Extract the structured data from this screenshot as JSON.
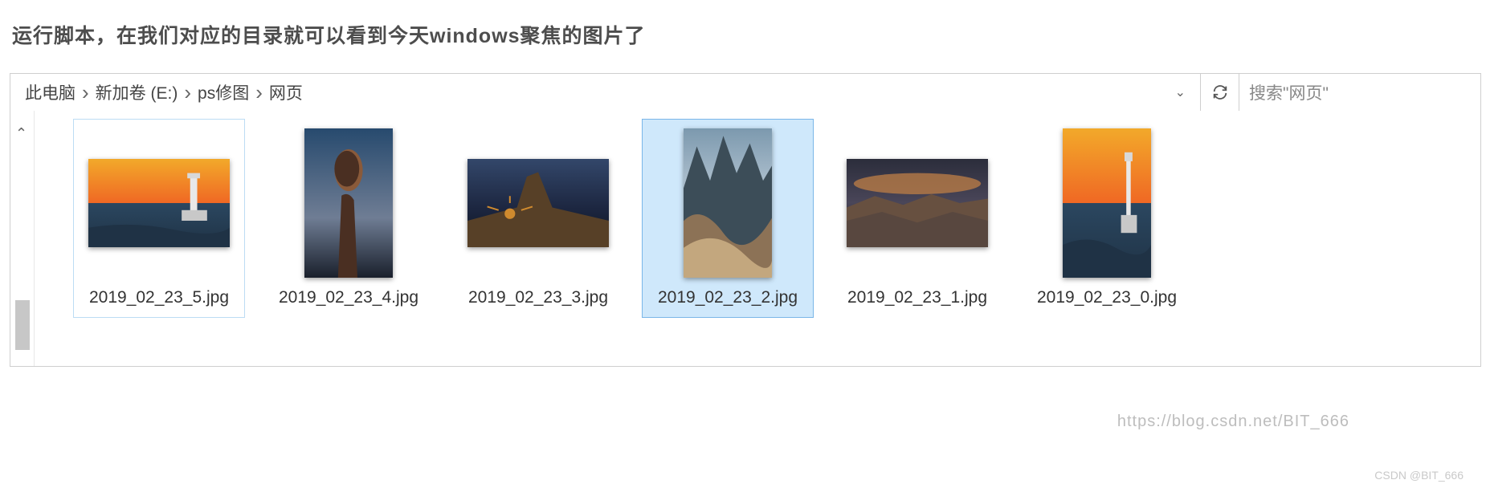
{
  "heading": "运行脚本，在我们对应的目录就可以看到今天windows聚焦的图片了",
  "breadcrumb": [
    "此电脑",
    "新加卷 (E:)",
    "ps修图",
    "网页"
  ],
  "search_placeholder": "搜索\"网页\"",
  "files": [
    {
      "name": "2019_02_23_5.jpg",
      "orient": "landscape",
      "selected": "soft",
      "palette": [
        "#f2a92a",
        "#f06824",
        "#1f3245",
        "#2b4760"
      ],
      "style": "lighthouse"
    },
    {
      "name": "2019_02_23_4.jpg",
      "orient": "portrait",
      "selected": "none",
      "palette": [
        "#274a6e",
        "#6f7d94",
        "#4a2f22",
        "#8a5a3a"
      ],
      "style": "balanced-rock"
    },
    {
      "name": "2019_02_23_3.jpg",
      "orient": "landscape",
      "selected": "none",
      "palette": [
        "#1d2741",
        "#33476a",
        "#574027",
        "#cf8a2e"
      ],
      "style": "sunset-rock"
    },
    {
      "name": "2019_02_23_2.jpg",
      "orient": "portrait",
      "selected": "main",
      "palette": [
        "#7c99ae",
        "#3c4d58",
        "#8c7256",
        "#c3a77e"
      ],
      "style": "dolomites"
    },
    {
      "name": "2019_02_23_1.jpg",
      "orient": "landscape",
      "selected": "none",
      "palette": [
        "#2b2d3b",
        "#4a4659",
        "#675040",
        "#b77b46"
      ],
      "style": "ridge"
    },
    {
      "name": "2019_02_23_0.jpg",
      "orient": "portrait",
      "selected": "none",
      "palette": [
        "#f2a92a",
        "#f06824",
        "#1f3245",
        "#2b4760"
      ],
      "style": "lighthouse-tall"
    }
  ],
  "watermark_img": "https://blog.csdn.net/BIT_666",
  "watermark_src": "CSDN @BIT_666"
}
